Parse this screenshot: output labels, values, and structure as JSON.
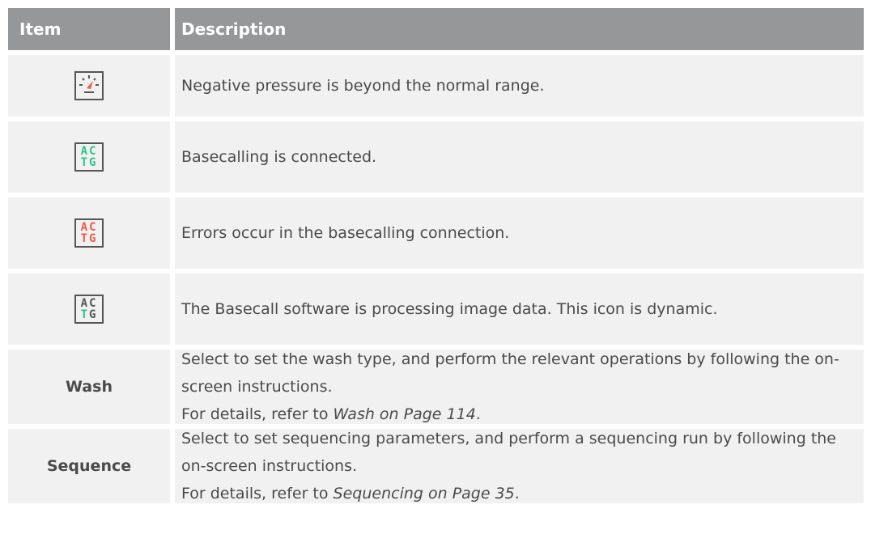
{
  "header": {
    "item": "Item",
    "description": "Description"
  },
  "rows": [
    {
      "icon": "pressure-gauge-icon",
      "description": "Negative pressure is beyond the normal range."
    },
    {
      "icon": "actg-green-icon",
      "icon_text_top": "AC",
      "icon_text_bottom": "TG",
      "description": "Basecalling is connected."
    },
    {
      "icon": "actg-red-icon",
      "icon_text_top": "AC",
      "icon_text_bottom": "TG",
      "description": "Errors occur in the basecalling connection."
    },
    {
      "icon": "actg-processing-icon",
      "icon_text_top": "AC",
      "icon_text_bottom_t": "T",
      "icon_text_bottom_g": "G",
      "description": "The Basecall software is processing image data. This icon is dynamic."
    },
    {
      "label": "Wash",
      "description": "Select to set the wash type, and perform the relevant operations by following the on-screen instructions.",
      "ref_prefix": "For details, refer to ",
      "ref": "Wash on Page 114",
      "ref_suffix": "."
    },
    {
      "label": "Sequence",
      "description": "Select to set sequencing parameters, and perform a sequencing run by following the on-screen instructions.",
      "ref_prefix": "For details, refer to ",
      "ref": "Sequencing on Page 35",
      "ref_suffix": "."
    }
  ],
  "colors": {
    "header_bg": "#959799",
    "row_bg": "#f1f1f2",
    "green": "#2cc38b",
    "red": "#f05a4a"
  }
}
